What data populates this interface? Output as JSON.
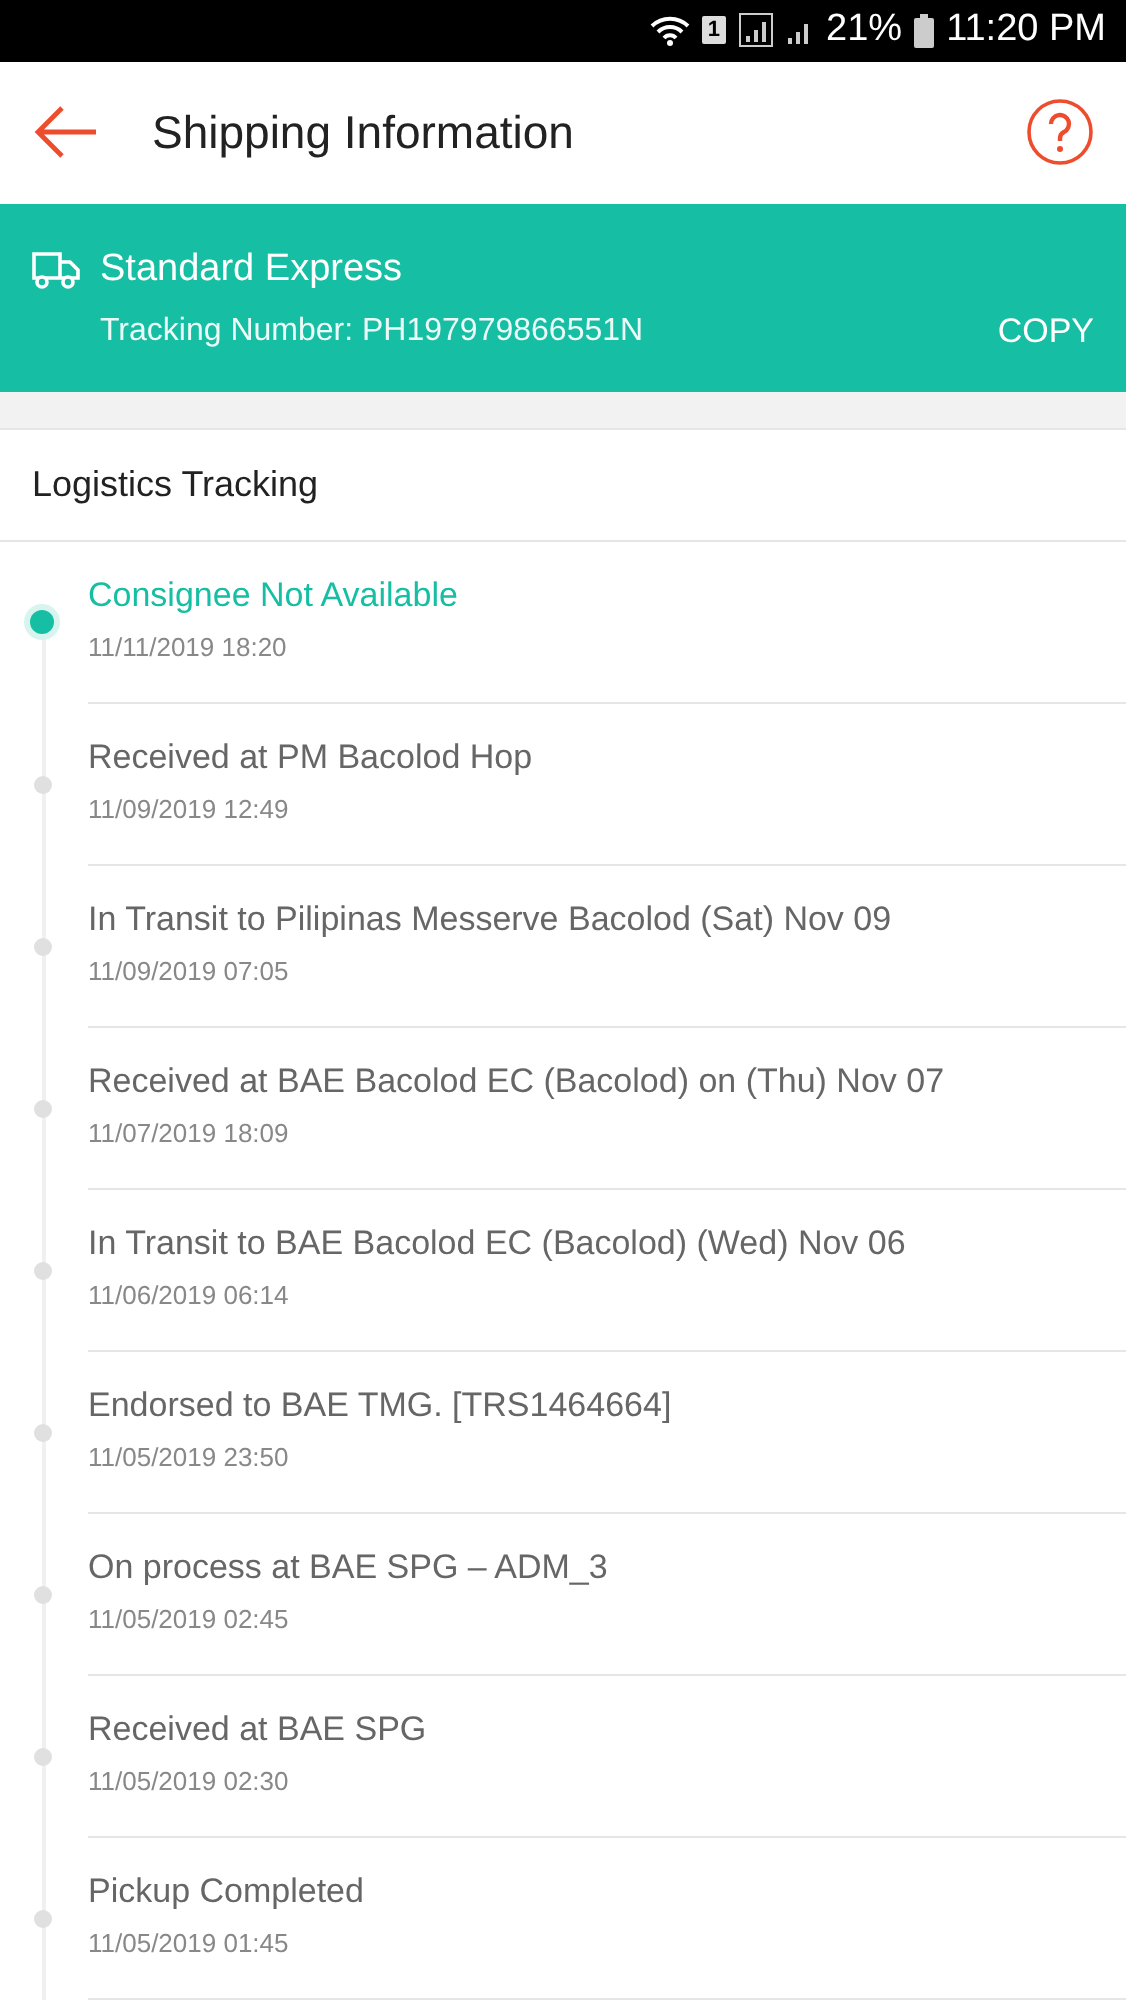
{
  "status_bar": {
    "sim_slot": "1",
    "battery": "21%",
    "time": "11:20 PM"
  },
  "header": {
    "title": "Shipping Information"
  },
  "shipment": {
    "service": "Standard Express",
    "tracking": "Tracking Number: PH197979866551N",
    "copy": "COPY"
  },
  "section_title": "Logistics Tracking",
  "events": [
    {
      "status": "Consignee Not Available",
      "time": "11/11/2019 18:20",
      "current": true
    },
    {
      "status": "Received at PM Bacolod Hop",
      "time": "11/09/2019 12:49",
      "current": false
    },
    {
      "status": "In Transit to Pilipinas Messerve Bacolod (Sat) Nov 09",
      "time": "11/09/2019 07:05",
      "current": false
    },
    {
      "status": "Received at BAE Bacolod EC (Bacolod) on (Thu) Nov 07",
      "time": "11/07/2019 18:09",
      "current": false
    },
    {
      "status": "In Transit to BAE Bacolod EC (Bacolod) (Wed) Nov 06",
      "time": "11/06/2019 06:14",
      "current": false
    },
    {
      "status": "Endorsed to BAE TMG. [TRS1464664]",
      "time": "11/05/2019 23:50",
      "current": false
    },
    {
      "status": "On process at BAE SPG – ADM_3",
      "time": "11/05/2019 02:45",
      "current": false
    },
    {
      "status": "Received at BAE SPG",
      "time": "11/05/2019 02:30",
      "current": false
    },
    {
      "status": "Pickup Completed",
      "time": "11/05/2019 01:45",
      "current": false
    }
  ]
}
